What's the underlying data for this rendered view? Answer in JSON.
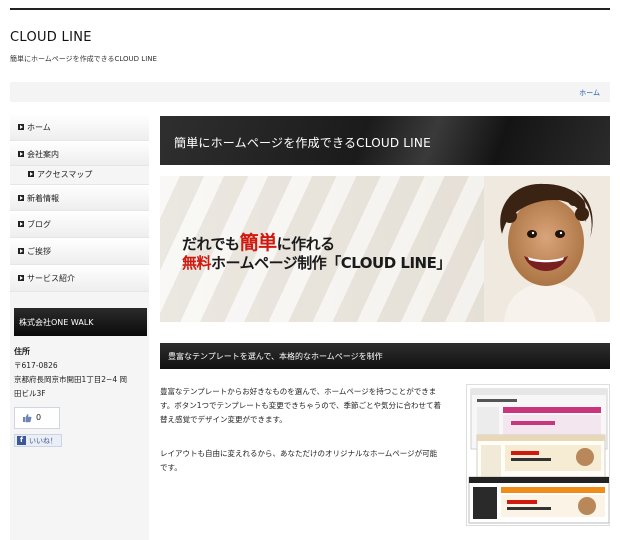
{
  "site": {
    "title": "CLOUD LINE",
    "tagline": "簡単にホームページを作成できるCLOUD LINE"
  },
  "breadcrumb": {
    "home": "ホーム"
  },
  "sidebar": {
    "nav": [
      {
        "label": "ホーム"
      },
      {
        "label": "会社案内"
      },
      {
        "label": "アクセスマップ"
      },
      {
        "label": "新着情報"
      },
      {
        "label": "ブログ"
      },
      {
        "label": "ご挨拶"
      },
      {
        "label": "サービス紹介"
      }
    ],
    "company_name": "株式会社ONE WALK",
    "address": {
      "heading": "住所",
      "postal": "〒617-0826",
      "line1": "京都府長岡京市開田1丁目2−4 岡",
      "line2": "田ビル3F"
    },
    "facebook": {
      "count": "0",
      "like_label": "いいね！"
    }
  },
  "main": {
    "page_title": "簡単にホームページを作成できるCLOUD LINE",
    "hero": {
      "line1_pre": "だれでも",
      "line1_highlight": "簡単",
      "line1_post": "に作れる",
      "line2_highlight": "無料",
      "line2_post": "ホームページ制作「CLOUD LINE」"
    },
    "section_heading": "豊富なテンプレートを選んで、本格的なホームページを制作",
    "paragraph1": [
      "豊富なテンプレートからお好きなものを選んで、ホームページを持つことができま",
      "す。ボタン1つでテンプレートも変更できちゃうので、季節ごとや気分に合わせて着",
      "替え感覚でデザイン変更ができます。"
    ],
    "paragraph2": [
      "レイアウトも自由に変えれるから、あなただけのオリジナルなホームページが可能",
      "です。"
    ]
  },
  "colors": {
    "accent_red": "#d0190f",
    "link_blue": "#1c5aa6",
    "dark_header": "#1b1b1b",
    "facebook_blue": "#3b5998"
  }
}
